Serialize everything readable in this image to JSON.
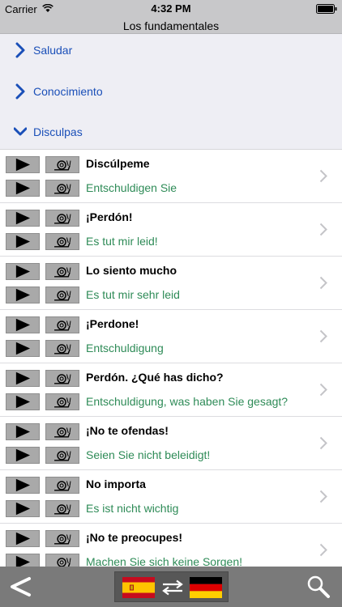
{
  "status_bar": {
    "carrier": "Carrier",
    "time": "4:32 PM"
  },
  "nav": {
    "title": "Los fundamentales"
  },
  "categories": [
    {
      "label": "Saludar",
      "state": "collapsed"
    },
    {
      "label": "Conocimiento",
      "state": "collapsed"
    },
    {
      "label": "Disculpas",
      "state": "expanded"
    }
  ],
  "phrases": [
    {
      "source": "Discúlpeme",
      "target": "Entschuldigen Sie"
    },
    {
      "source": "¡Perdón!",
      "target": "Es tut mir leid!"
    },
    {
      "source": "Lo siento mucho",
      "target": "Es tut mir sehr leid"
    },
    {
      "source": "¡Perdone!",
      "target": "Entschuldigung"
    },
    {
      "source": "Perdón. ¿Qué has dicho?",
      "target": "Entschuldigung, was haben Sie gesagt?"
    },
    {
      "source": "¡No te ofendas!",
      "target": "Seien Sie nicht beleidigt!"
    },
    {
      "source": "No importa",
      "target": "Es ist nicht wichtig"
    },
    {
      "source": "¡No te preocupes!",
      "target": "Machen Sie sich keine Sorgen!"
    }
  ],
  "icons": {
    "play": "play-icon",
    "slow": "snail-icon",
    "row_disclosure": "chevron-right-icon",
    "back": "back-arrow-icon",
    "search": "search-icon",
    "swap": "swap-arrows-icon",
    "source_flag": "spain-flag-icon",
    "target_flag": "germany-flag-icon"
  },
  "colors": {
    "category_text": "#1a4fb8",
    "translation_text": "#2e8b57",
    "bars": "#c8c8ca",
    "bottom_bar": "#7a7a7a"
  }
}
